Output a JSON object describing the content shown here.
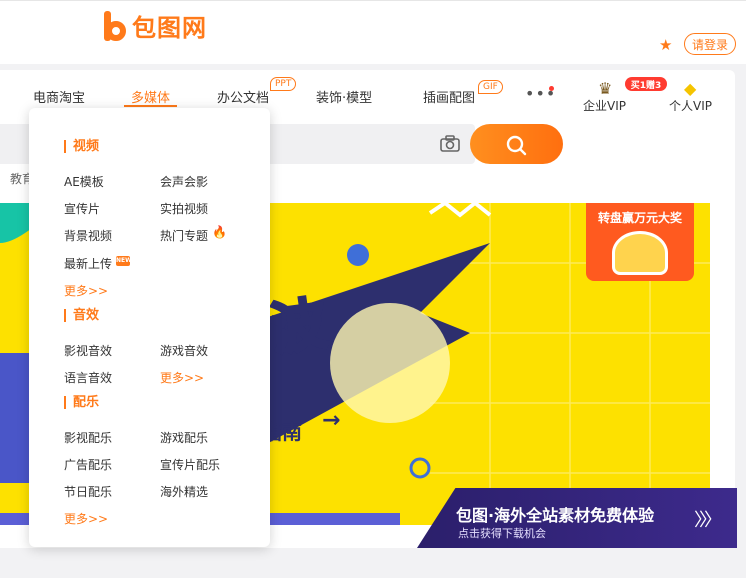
{
  "header": {
    "logo_text": "包图网",
    "login_label": "请登录"
  },
  "nav": {
    "items": [
      {
        "label": "电商淘宝"
      },
      {
        "label": "多媒体"
      },
      {
        "label": "办公文档",
        "badge": "PPT"
      },
      {
        "label": "装饰·模型"
      },
      {
        "label": "插画配图",
        "badge": "GIF"
      }
    ],
    "more_label": "•••",
    "enterprise_vip_label": "企业VIP",
    "personal_vip_label": "个人VIP",
    "promo_badge": "买1赠3"
  },
  "search": {
    "hot_label": "教育"
  },
  "banner": {
    "big_text": "波",
    "small_text": "指南",
    "lottery_title": "转盘赢万元大奖",
    "trial_title": "包图·海外全站素材免费体验",
    "trial_subtitle": "点击获得下载机会",
    "accent_color": "#fde100"
  },
  "dropdown": {
    "sections": [
      {
        "title": "视频",
        "items": [
          "AE模板",
          "会声会影",
          "宣传片",
          "实拍视频",
          "背景视频",
          "热门专题",
          "最新上传"
        ],
        "more": "更多>>"
      },
      {
        "title": "音效",
        "items": [
          "影视音效",
          "游戏音效",
          "语言音效"
        ],
        "more": "更多>>"
      },
      {
        "title": "配乐",
        "items": [
          "影视配乐",
          "游戏配乐",
          "广告配乐",
          "宣传片配乐",
          "节日配乐",
          "海外精选"
        ],
        "more": "更多>>"
      }
    ],
    "new_badge": "NEW"
  },
  "colors": {
    "brand": "#ff7a1a",
    "hot": "#ff3b30"
  }
}
